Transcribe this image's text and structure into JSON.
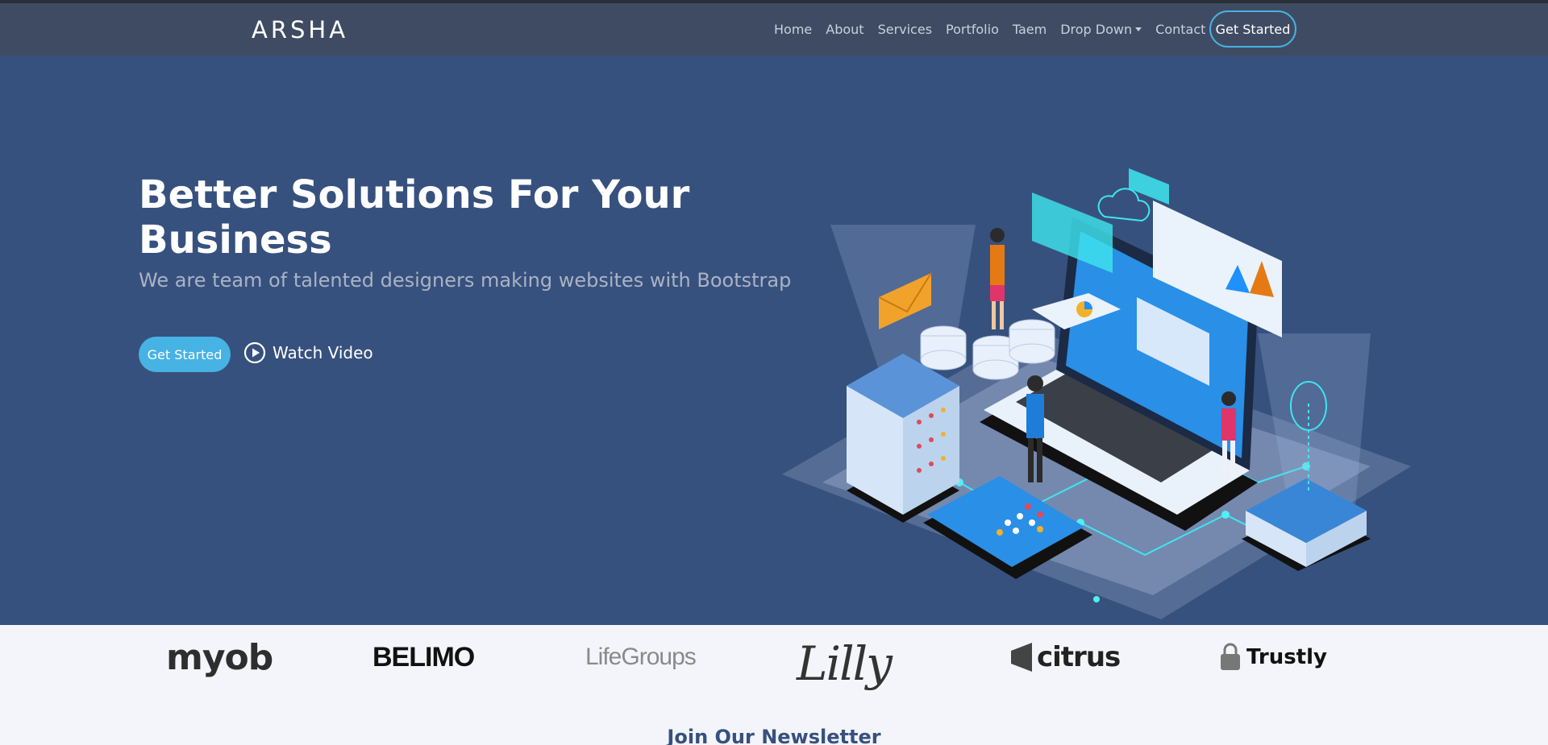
{
  "header": {
    "logo": "ARSHA",
    "nav": [
      "Home",
      "About",
      "Services",
      "Portfolio",
      "Taem",
      "Drop Down",
      "Contact"
    ],
    "cta": "Get Started"
  },
  "hero": {
    "title": "Better Solutions For Your Business",
    "subtitle": "We are team of talented designers making websites with Bootstrap",
    "get_started": "Get Started",
    "watch_video": "Watch Video"
  },
  "clients": [
    "myob",
    "BELIMO",
    "LifeGroups",
    "Lilly",
    "citrus",
    "Trustly"
  ],
  "newsletter": {
    "title": "Join Our Newsletter"
  },
  "colors": {
    "accent": "#47b2e4",
    "hero_bg": "#37517e",
    "header_bg": "#3f4b63"
  }
}
